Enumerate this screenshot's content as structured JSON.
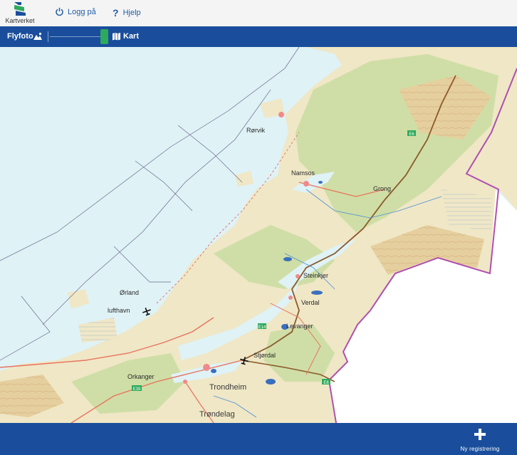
{
  "header": {
    "logo_text": "Kartverket",
    "login_label": "Logg på",
    "help_label": "Hjelp"
  },
  "toolbar": {
    "flyfoto_label": "Flyfoto",
    "kart_label": "Kart",
    "basemap_toggle_position": "kart"
  },
  "map": {
    "places": {
      "rorvik": "Rørvik",
      "namsos": "Namsos",
      "grong": "Grong",
      "steinkjer": "Steinkjer",
      "verdal": "Verdal",
      "levanger": "Levanger",
      "orland": "Ørland",
      "lufthavn": "lufthavn",
      "stjordal": "Stjørdal",
      "orkanger": "Orkanger",
      "trondheim": "Trondheim",
      "trondelag": "Trøndelag"
    },
    "road_labels": {
      "e6_north": "E6",
      "e14": "E14",
      "e39": "E39",
      "e6_south": "E6"
    },
    "colors": {
      "sea": "#dff2f6",
      "land": "#efe7c6",
      "forest": "#c9dca0",
      "mountain": "#e6cf9e",
      "border": "#b04fb0",
      "road": "#e8735d",
      "outside": "#ffffff"
    }
  },
  "footer": {
    "new_registration_label": "Ny registrering"
  }
}
